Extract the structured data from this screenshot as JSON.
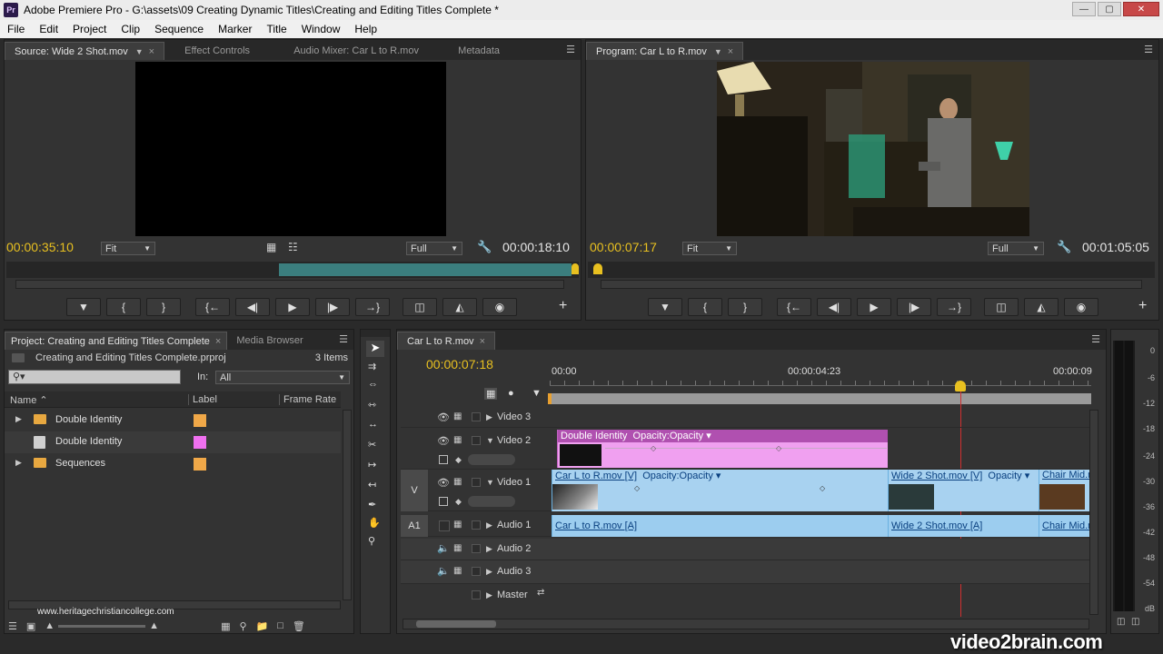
{
  "window": {
    "title": "Adobe Premiere Pro - G:\\assets\\09 Creating Dynamic Titles\\Creating and Editing Titles Complete *",
    "app_badge": "Pr"
  },
  "menu": [
    "File",
    "Edit",
    "Project",
    "Clip",
    "Sequence",
    "Marker",
    "Title",
    "Window",
    "Help"
  ],
  "source_monitor": {
    "tabs": [
      "Source: Wide 2 Shot.mov",
      "Effect Controls",
      "Audio Mixer: Car L to R.mov",
      "Metadata"
    ],
    "timecode_left": "00:00:35:10",
    "fit": "Fit",
    "quality": "Full",
    "timecode_right": "00:00:18:10"
  },
  "program_monitor": {
    "tab": "Program: Car L to R.mov",
    "timecode_left": "00:00:07:17",
    "fit": "Fit",
    "quality": "Full",
    "timecode_right": "00:01:05:05"
  },
  "project": {
    "tabs": [
      "Project: Creating and Editing Titles Complete",
      "Media Browser"
    ],
    "filename": "Creating and Editing Titles Complete.prproj",
    "item_count": "3 Items",
    "in_label": "In:",
    "in_value": "All",
    "columns": [
      "Name",
      "Label",
      "Frame Rate"
    ],
    "items": [
      {
        "name": "Double Identity",
        "type": "bin",
        "color": "#f0a848"
      },
      {
        "name": "Double Identity",
        "type": "sequence",
        "color": "#f070f0"
      },
      {
        "name": "Sequences",
        "type": "bin",
        "color": "#f0a848"
      }
    ],
    "watermark": "www.heritagechristiancollege.com"
  },
  "timeline": {
    "tab": "Car L to R.mov",
    "timecode": "00:00:07:18",
    "ruler": [
      "00:00",
      "00:00:04:23",
      "00:00:09"
    ],
    "tracks": {
      "video3": "Video 3",
      "video2": "Video 2",
      "video1": "Video 1",
      "audio1": "Audio 1",
      "audio2": "Audio 2",
      "audio3": "Audio 3",
      "master": "Master"
    },
    "v_label": "V",
    "a1_label": "A1",
    "v2_clip": {
      "name": "Double Identity",
      "fx": "Opacity:Opacity"
    },
    "v1_clips": [
      {
        "name": "Car L to R.mov [V]",
        "fx": "Opacity:Opacity"
      },
      {
        "name": "Wide 2 Shot.mov [V]",
        "fx": "Opacity"
      },
      {
        "name": "Chair Mid.m"
      }
    ],
    "a1_clips": [
      "Car L to R.mov [A]",
      "Wide 2 Shot.mov [A]",
      "Chair Mid.m"
    ]
  },
  "vu_scale": [
    "0",
    "-6",
    "-12",
    "-18",
    "-24",
    "-30",
    "-36",
    "-42",
    "-48",
    "-54",
    "dB"
  ],
  "branding": "video2brain.com",
  "colors": {
    "accent_timecode": "#e8c020",
    "clip_video": "#a8d2f0",
    "clip_pink": "#f0a0f0",
    "playhead": "#d03030"
  }
}
